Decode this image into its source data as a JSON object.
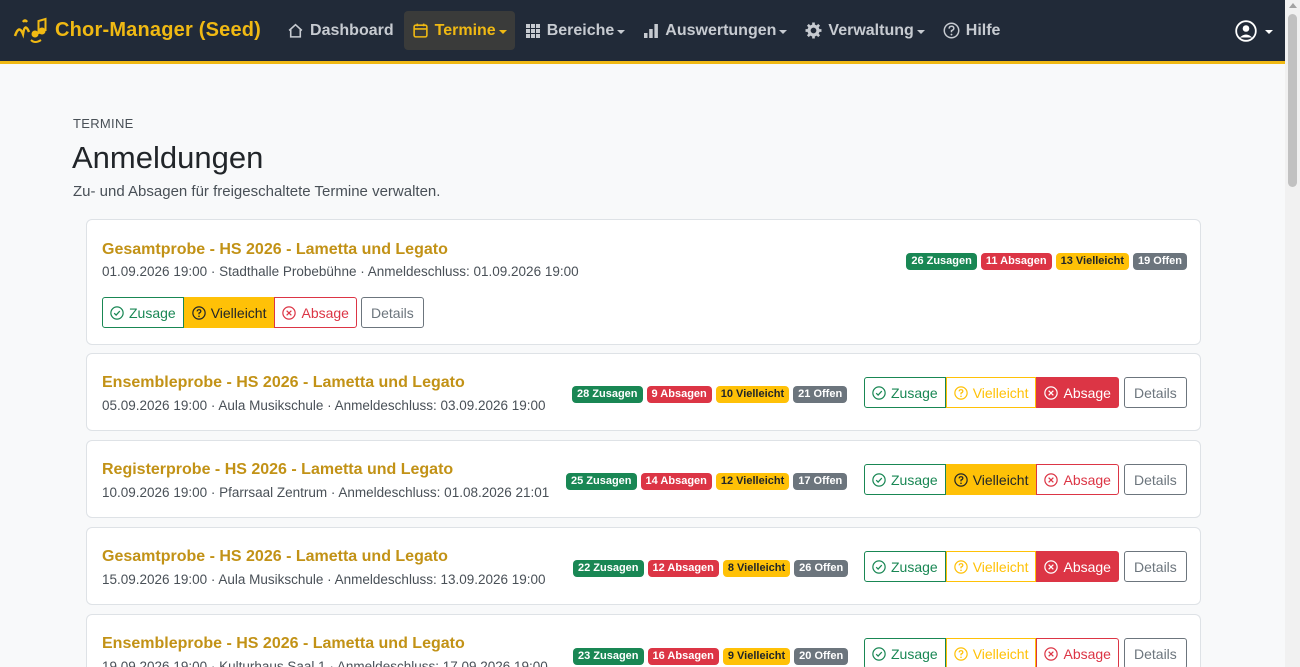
{
  "app": {
    "brand": "Chor-Manager (Seed)"
  },
  "nav": {
    "dashboard": "Dashboard",
    "termine": "Termine",
    "bereiche": "Bereiche",
    "auswertungen": "Auswertungen",
    "verwaltung": "Verwaltung",
    "hilfe": "Hilfe"
  },
  "page": {
    "overline": "TERMINE",
    "title": "Anmeldungen",
    "subtitle": "Zu- und Absagen für freigeschaltete Termine verwalten."
  },
  "buttons": {
    "zusage": "Zusage",
    "vielleicht": "Vielleicht",
    "absage": "Absage",
    "details": "Details"
  },
  "colors": {
    "brand": "#f0b913",
    "navbar": "#212a38",
    "success": "#198754",
    "danger": "#dc3545",
    "warning": "#ffc107",
    "secondary": "#6c757d"
  },
  "events": [
    {
      "title": "Gesamtprobe - HS 2026 - Lametta und Legato",
      "meta": "01.09.2026 19:00 · Stadthalle Probebühne · Anmeldeschluss: 01.09.2026 19:00",
      "zusagen": "26 Zusagen",
      "absagen": "11 Absagen",
      "vielleicht": "13 Vielleicht",
      "offen": "19 Offen",
      "selected": "vielleicht"
    },
    {
      "title": "Ensembleprobe - HS 2026 - Lametta und Legato",
      "meta": "05.09.2026 19:00 · Aula Musikschule · Anmeldeschluss: 03.09.2026 19:00",
      "zusagen": "28 Zusagen",
      "absagen": "9 Absagen",
      "vielleicht": "10 Vielleicht",
      "offen": "21 Offen",
      "selected": "absage"
    },
    {
      "title": "Registerprobe - HS 2026 - Lametta und Legato",
      "meta": "10.09.2026 19:00 · Pfarrsaal Zentrum · Anmeldeschluss: 01.08.2026 21:01",
      "zusagen": "25 Zusagen",
      "absagen": "14 Absagen",
      "vielleicht": "12 Vielleicht",
      "offen": "17 Offen",
      "selected": "vielleicht"
    },
    {
      "title": "Gesamtprobe - HS 2026 - Lametta und Legato",
      "meta": "15.09.2026 19:00 · Aula Musikschule · Anmeldeschluss: 13.09.2026 19:00",
      "zusagen": "22 Zusagen",
      "absagen": "12 Absagen",
      "vielleicht": "8 Vielleicht",
      "offen": "26 Offen",
      "selected": "absage"
    },
    {
      "title": "Ensembleprobe - HS 2026 - Lametta und Legato",
      "meta": "19.09.2026 19:00 · Kulturhaus Saal 1 · Anmeldeschluss: 17.09.2026 19:00",
      "zusagen": "23 Zusagen",
      "absagen": "16 Absagen",
      "vielleicht": "9 Vielleicht",
      "offen": "20 Offen",
      "selected": "none"
    }
  ]
}
